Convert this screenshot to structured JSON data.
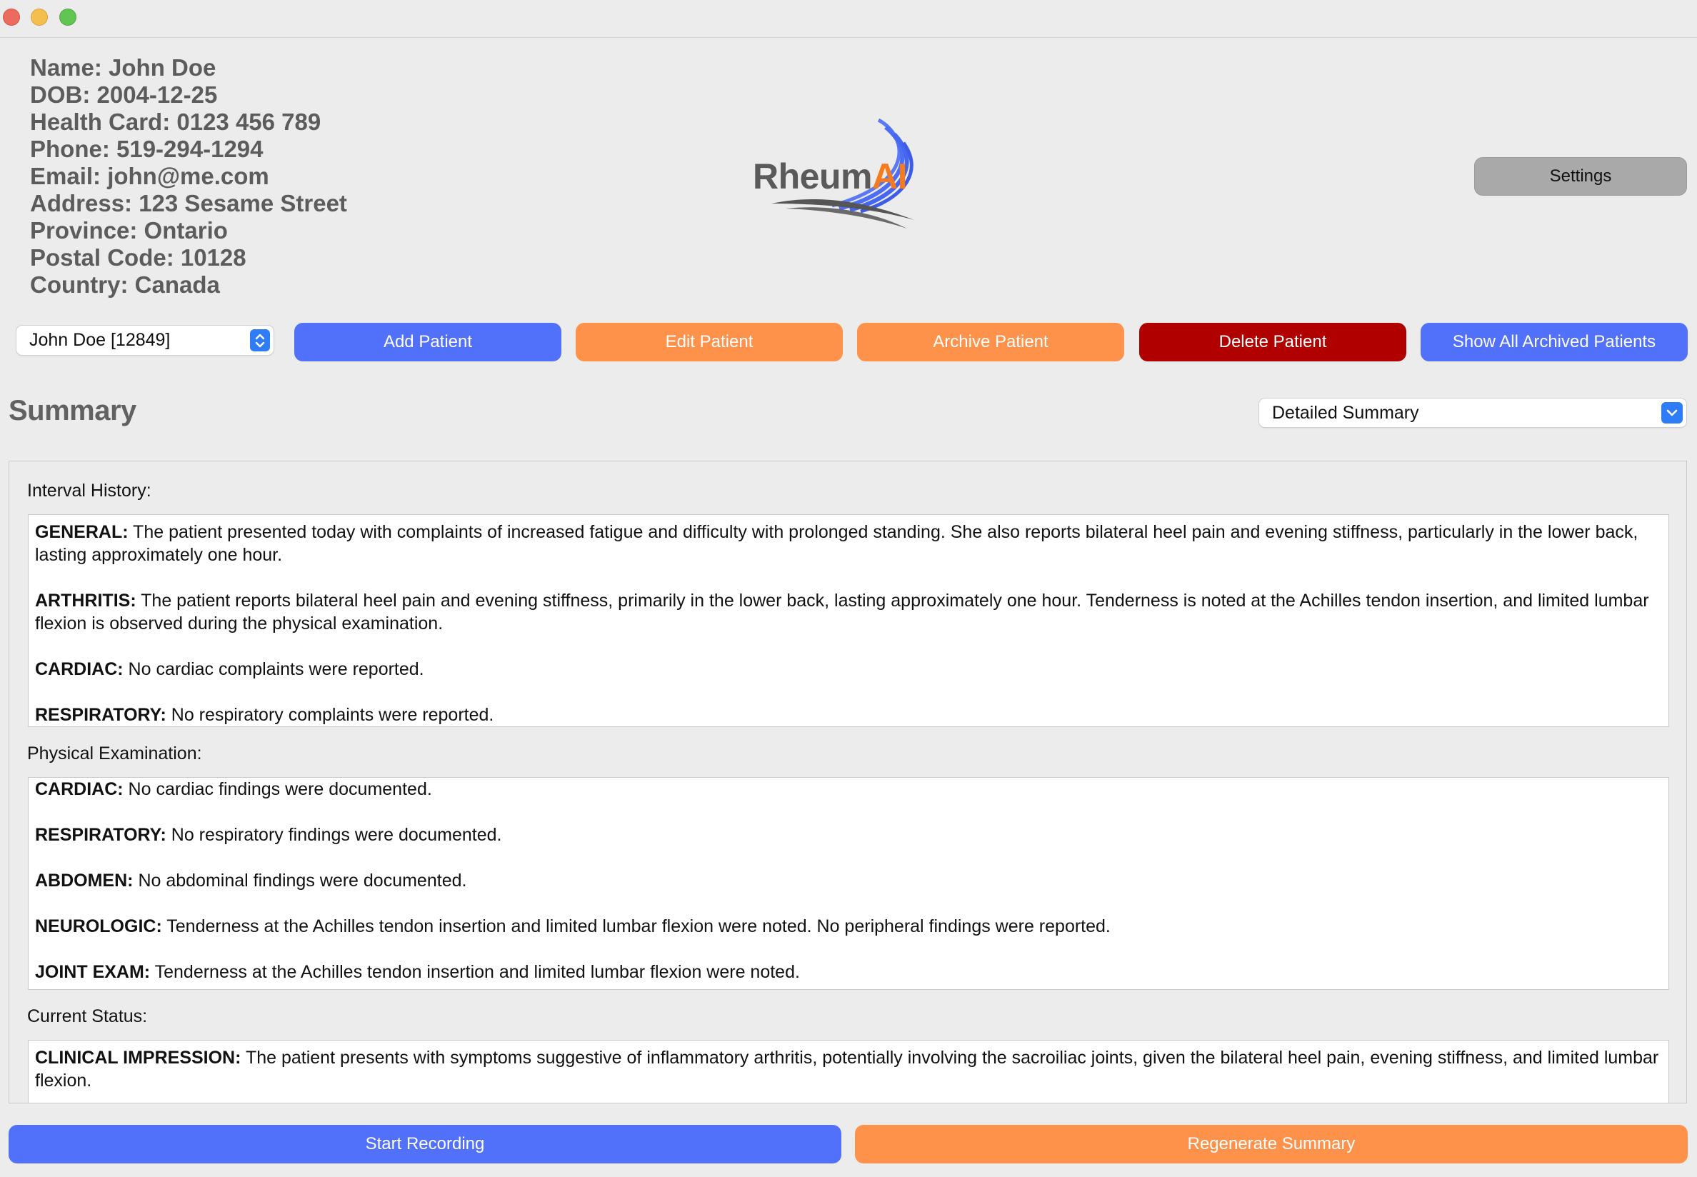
{
  "patient": {
    "name": "Name: John Doe",
    "dob": "DOB: 2004-12-25",
    "health_card": "Health Card: 0123 456 789",
    "phone": "Phone: 519-294-1294",
    "email": "Email: john@me.com",
    "address": "Address: 123 Sesame Street",
    "province": "Province: Ontario",
    "postal_code": "Postal Code: 10128",
    "country": "Country: Canada"
  },
  "logo": {
    "rheum": "Rheum",
    "ai": "AI"
  },
  "settings_label": "Settings",
  "toolbar": {
    "patient_select": "John Doe [12849]",
    "add": "Add Patient",
    "edit": "Edit Patient",
    "archive": "Archive Patient",
    "delete": "Delete Patient",
    "show_archived": "Show All Archived Patients"
  },
  "summary": {
    "title": "Summary",
    "type_select": "Detailed Summary",
    "interval_history": {
      "label": "Interval History:",
      "entries": [
        {
          "key": "GENERAL:",
          "text": " The patient presented today with complaints of increased fatigue and difficulty with prolonged standing. She also reports bilateral heel pain and evening stiffness, particularly in the lower back, lasting approximately one hour."
        },
        {
          "key": "ARTHRITIS:",
          "text": " The patient reports bilateral heel pain and evening stiffness, primarily in the lower back, lasting approximately one hour. Tenderness is noted at the Achilles tendon insertion, and limited lumbar flexion is observed during the physical examination."
        },
        {
          "key": "CARDIAC:",
          "text": " No cardiac complaints were reported."
        },
        {
          "key": "RESPIRATORY:",
          "text": " No respiratory complaints were reported."
        }
      ]
    },
    "physical_exam": {
      "label": "Physical Examination:",
      "entries": [
        {
          "key": "CARDIAC:",
          "text": " No cardiac findings were documented."
        },
        {
          "key": "RESPIRATORY:",
          "text": " No respiratory findings were documented."
        },
        {
          "key": "ABDOMEN:",
          "text": " No abdominal findings were documented."
        },
        {
          "key": "NEUROLOGIC:",
          "text": " Tenderness at the Achilles tendon insertion and limited lumbar flexion were noted. No peripheral findings were reported."
        },
        {
          "key": "JOINT EXAM:",
          "text": " Tenderness at the Achilles tendon insertion and limited lumbar flexion were noted."
        }
      ]
    },
    "current_status": {
      "label": "Current Status:",
      "entries": [
        {
          "key": "CLINICAL IMPRESSION:",
          "text": " The patient presents with symptoms suggestive of inflammatory arthritis, potentially involving the sacroiliac joints, given the bilateral heel pain, evening stiffness, and limited lumbar flexion."
        }
      ]
    }
  },
  "bottom": {
    "start_recording": "Start Recording",
    "regenerate": "Regenerate Summary"
  },
  "colors": {
    "blue": "#5271fa",
    "orange": "#fe924b",
    "red": "#b00000",
    "gray": "#a9a9a9"
  }
}
